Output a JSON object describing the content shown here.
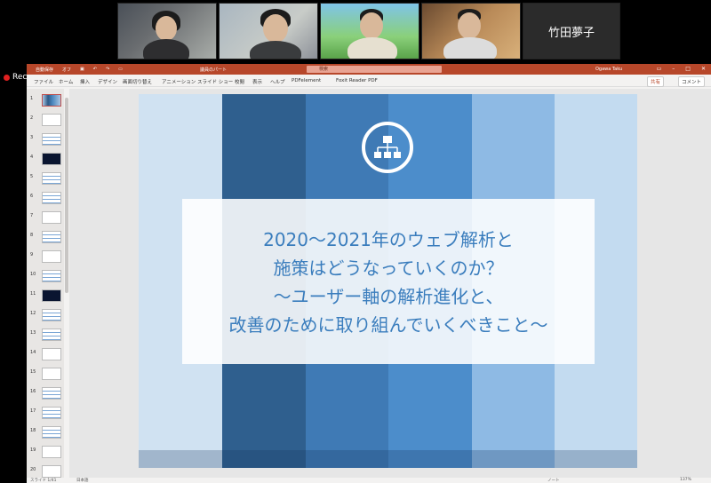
{
  "participants": [
    {
      "name": ""
    },
    {
      "name": ""
    },
    {
      "name": ""
    },
    {
      "name": ""
    },
    {
      "name": "竹田夢子"
    }
  ],
  "recording_label": "Recording...",
  "ppt": {
    "quick_access": [
      "自動保存",
      "オフ"
    ],
    "doc_title": "議員のパート",
    "search_placeholder": "検索",
    "user": "Ogawa Taku",
    "menu": [
      "ファイル",
      "ホーム",
      "挿入",
      "デザイン",
      "画面切り替え",
      "アニメーション",
      "スライド ショー",
      "校閲",
      "表示",
      "ヘルプ",
      "PDFelement",
      "Foxit Reader PDF"
    ],
    "share_label": "共有",
    "comment_label": "コメント",
    "slide_numbers": [
      "1",
      "2",
      "3",
      "4",
      "5",
      "6",
      "7",
      "8",
      "9",
      "10",
      "11",
      "12",
      "13",
      "14",
      "15",
      "16",
      "17",
      "18",
      "19",
      "20"
    ],
    "status": {
      "slide_info": "スライド 1/41",
      "language": "日本語",
      "notes": "ノート",
      "zoom": "137%"
    }
  },
  "slide": {
    "title_lines": [
      "2020～2021年のウェブ解析と",
      "施策はどうなっていくのか？",
      "～ユーザー軸の解析進化と、",
      "改善のために取り組んでいくべきこと～"
    ],
    "colors": {
      "title": "#3a7dbd",
      "accent": "#b7472a"
    },
    "icon": "network-diagram-icon"
  }
}
